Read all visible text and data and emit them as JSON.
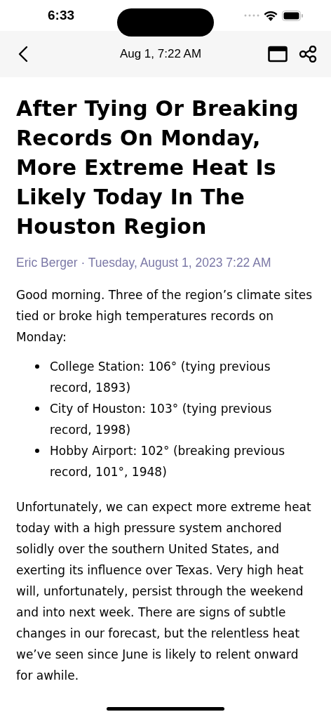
{
  "status_bar": {
    "time": "6:33"
  },
  "nav_bar": {
    "title": "Aug 1, 7:22 AM"
  },
  "article": {
    "title": "After Tying Or Breaking Records On Monday, More Extreme Heat Is Likely Today In The Houston Region",
    "byline": "Eric Berger · Tuesday, August 1, 2023 7:22 AM",
    "intro": "Good morning. Three of the region’s climate sites tied or broke high temperatures records on Monday:",
    "list": [
      "College Station: 106° (tying previous record, 1893)",
      "City of Houston: 103° (tying previous record, 1998)",
      "Hobby Airport: 102° (breaking previous record, 101°, 1948)"
    ],
    "paragraph": "Unfortunately, we can expect more extreme heat today with a high pressure system anchored solidly over the southern United States, and exerting its influence over Texas. Very high heat will, unfortunately, persist through the weekend and into next week. There are signs of subtle changes in our forecast, but the relentless heat we’ve seen since June is likely to relent onward for awhile."
  }
}
